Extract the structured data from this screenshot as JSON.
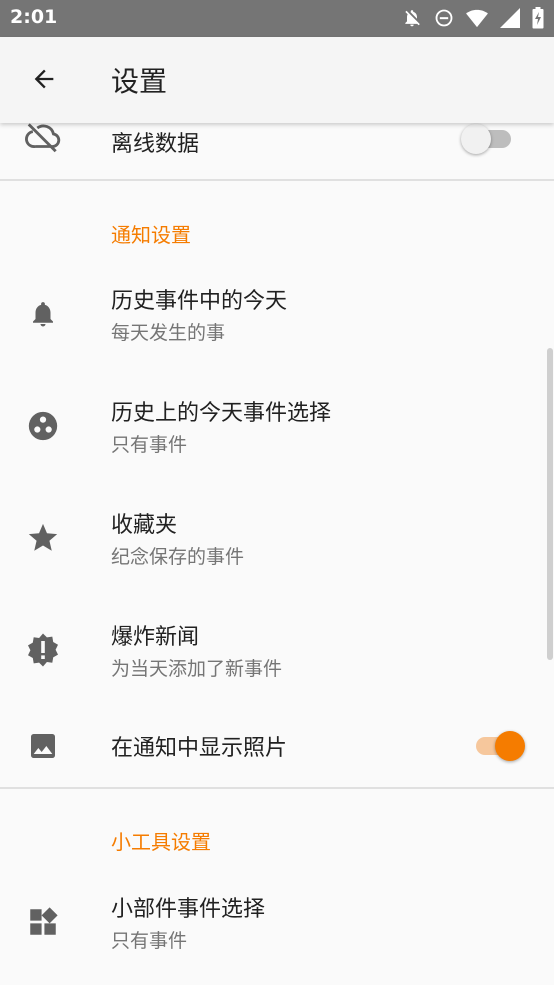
{
  "status_bar": {
    "time": "2:01",
    "icons": [
      "notifications-off-icon",
      "do-not-disturb-icon",
      "wifi-icon",
      "cell-signal-icon",
      "battery-charging-icon"
    ]
  },
  "app_bar": {
    "title": "设置"
  },
  "offline": {
    "title": "离线数据",
    "icon": "cloud-off-icon",
    "toggle_on": false
  },
  "sections": [
    {
      "header": "通知设置",
      "items": [
        {
          "title": "历史事件中的今天",
          "subtitle": "每天发生的事",
          "icon": "bell-icon"
        },
        {
          "title": "历史上的今天事件选择",
          "subtitle": "只有事件",
          "icon": "categories-icon"
        },
        {
          "title": "收藏夹",
          "subtitle": "纪念保存的事件",
          "icon": "star-icon"
        },
        {
          "title": "爆炸新闻",
          "subtitle": "为当天添加了新事件",
          "icon": "alert-badge-icon"
        },
        {
          "title": "在通知中显示照片",
          "icon": "image-icon",
          "toggle_on": true
        }
      ]
    },
    {
      "header": "小工具设置",
      "items": [
        {
          "title": "小部件事件选择",
          "subtitle": "只有事件",
          "icon": "widgets-icon"
        }
      ]
    }
  ],
  "colors": {
    "accent": "#f57c00",
    "status_bar": "#757575",
    "background": "#fafafa"
  }
}
